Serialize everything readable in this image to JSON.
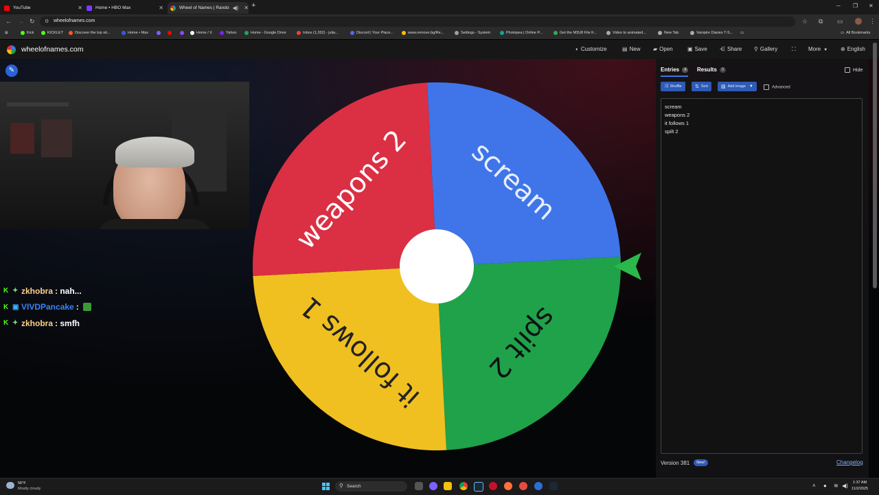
{
  "browser": {
    "tabs": [
      {
        "title": "YouTube",
        "color": "#ff0000"
      },
      {
        "title": "Home • HBO Max",
        "color": "#7a3cff"
      },
      {
        "title": "Wheel of Names | Random",
        "color": "#3f75e8"
      }
    ],
    "url": "wheelofnames.com",
    "bookmarks": [
      {
        "label": "Kick",
        "color": "#53fc18"
      },
      {
        "label": "KICKLET",
        "color": "#53fc18"
      },
      {
        "label": "Discover the top str...",
        "color": "#ff5a1f"
      },
      {
        "label": "Home • Max",
        "color": "#3b5bdb"
      },
      {
        "label": "",
        "color": "#7b61ff"
      },
      {
        "label": "",
        "color": "#ff0000"
      },
      {
        "label": "",
        "color": "#9146ff"
      },
      {
        "label": "Home / X",
        "color": "#ffffff"
      },
      {
        "label": "Yahoo",
        "color": "#7e1fff"
      },
      {
        "label": "Home - Google Drive",
        "color": "#1fa463"
      },
      {
        "label": "Inbox (1,352) - julia...",
        "color": "#ea4335"
      },
      {
        "label": "Discord | Your Place...",
        "color": "#5865f2"
      },
      {
        "label": "www.remove.bg/Re...",
        "color": "#ffbf00"
      },
      {
        "label": "Settings - System",
        "color": "#9aa0a6"
      },
      {
        "label": "Photopea | Online P...",
        "color": "#18a497"
      },
      {
        "label": "Get the M3U8 File fr...",
        "color": "#34a853"
      },
      {
        "label": "Video to animated...",
        "color": "#aaaaaa"
      },
      {
        "label": "New Tab",
        "color": "#aaaaaa"
      },
      {
        "label": "Vampire Diaries T-S...",
        "color": "#aaaaaa"
      }
    ],
    "all_bookmarks": "All Bookmarks"
  },
  "header": {
    "site_title": "wheelofnames.com",
    "buttons": [
      {
        "label": "Customize",
        "icon": "palette-icon",
        "glyph": "◐"
      },
      {
        "label": "New",
        "icon": "file-icon",
        "glyph": "▤"
      },
      {
        "label": "Open",
        "icon": "folder-icon",
        "glyph": "▰"
      },
      {
        "label": "Save",
        "icon": "save-icon",
        "glyph": "▣"
      },
      {
        "label": "Share",
        "icon": "share-icon",
        "glyph": "⋲"
      },
      {
        "label": "Gallery",
        "icon": "search-icon",
        "glyph": "⚲"
      },
      {
        "label": "",
        "icon": "fullscreen-icon",
        "glyph": "⛶"
      },
      {
        "label": "More",
        "icon": "chevron-down-icon",
        "glyph": ""
      },
      {
        "label": "English",
        "icon": "globe-icon",
        "glyph": "⊕"
      }
    ]
  },
  "chat": [
    {
      "user": "zkhobra",
      "user_color": "#ffd38a",
      "message": ": nah..."
    },
    {
      "user": "VIVDPancake",
      "user_color": "#3b82f6",
      "message": ":"
    },
    {
      "user": "zkhobra",
      "user_color": "#ffd38a",
      "message": ": smfh"
    }
  ],
  "wheel": {
    "slices": [
      {
        "label": "scream",
        "color": "#3f75e8"
      },
      {
        "label": "spilt 2",
        "color": "#1fa24a"
      },
      {
        "label": "it follows 1",
        "color": "#f0c020"
      },
      {
        "label": "weapons 2",
        "color": "#db2f44"
      }
    ],
    "pointer_color": "#2bb84a"
  },
  "panel": {
    "tabs": {
      "entries": {
        "label": "Entries",
        "count": "4"
      },
      "results": {
        "label": "Results",
        "count": "0"
      }
    },
    "hide_label": "Hide",
    "toolbar": {
      "shuffle": "Shuffle",
      "sort": "Sort",
      "add_image": "Add image",
      "advanced": "Advanced"
    },
    "entries": [
      "scream",
      "weapons 2",
      "it follows 1",
      "spilt 2"
    ],
    "version": "Version 381",
    "new_badge": "New!",
    "changelog": "Changelog"
  },
  "taskbar": {
    "weather_temp": "56°F",
    "weather_desc": "Mostly cloudy",
    "search_placeholder": "Search",
    "time": "1:37 AM",
    "date": "11/2/2025"
  }
}
